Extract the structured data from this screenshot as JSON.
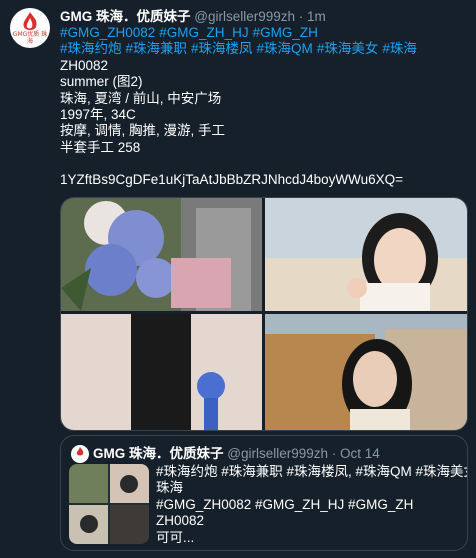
{
  "tweet": {
    "author_name": "GMG 珠海．优质妹子",
    "handle": "@girlseller999zh",
    "separator": "·",
    "time": "1m",
    "avatar_text": "GMG优质\n珠海",
    "hashtags_line1": [
      "#GMG_ZH0082",
      "#GMG_ZH_HJ",
      "#GMG_ZH"
    ],
    "hashtags_line2": [
      "#珠海约炮",
      "#珠海兼职",
      "#珠海楼凤",
      "#珠海QM",
      "#珠海美女",
      "#珠海"
    ],
    "lines": [
      "ZH0082",
      "summer (图2)",
      "珠海, 夏湾 / 前山, 中安广场",
      "1997年, 34C",
      "按摩, 调情, 胸推, 漫游, 手工",
      "半套手工 258",
      "",
      "1YZftBs9CgDFe1uKjTaAtJbBbZRJNhcdJ4boyWWu6XQ="
    ]
  },
  "quote": {
    "author_name": "GMG 珠海．优质妹子",
    "handle": "@girlseller999zh",
    "separator": "·",
    "date": "Oct 14",
    "tags_line1": "#珠海约炮 #珠海兼职 #珠海楼凤, #珠海QM #珠海美女 #",
    "tags_line2": "珠海",
    "tags_line3": "#GMG_ZH0082 #GMG_ZH_HJ  #GMG_ZH",
    "code": "ZH0082",
    "snippet": "可可..."
  },
  "colors": {
    "background": "#15202b",
    "link": "#1da1f2",
    "muted": "#8899a6",
    "border": "#38444d"
  }
}
